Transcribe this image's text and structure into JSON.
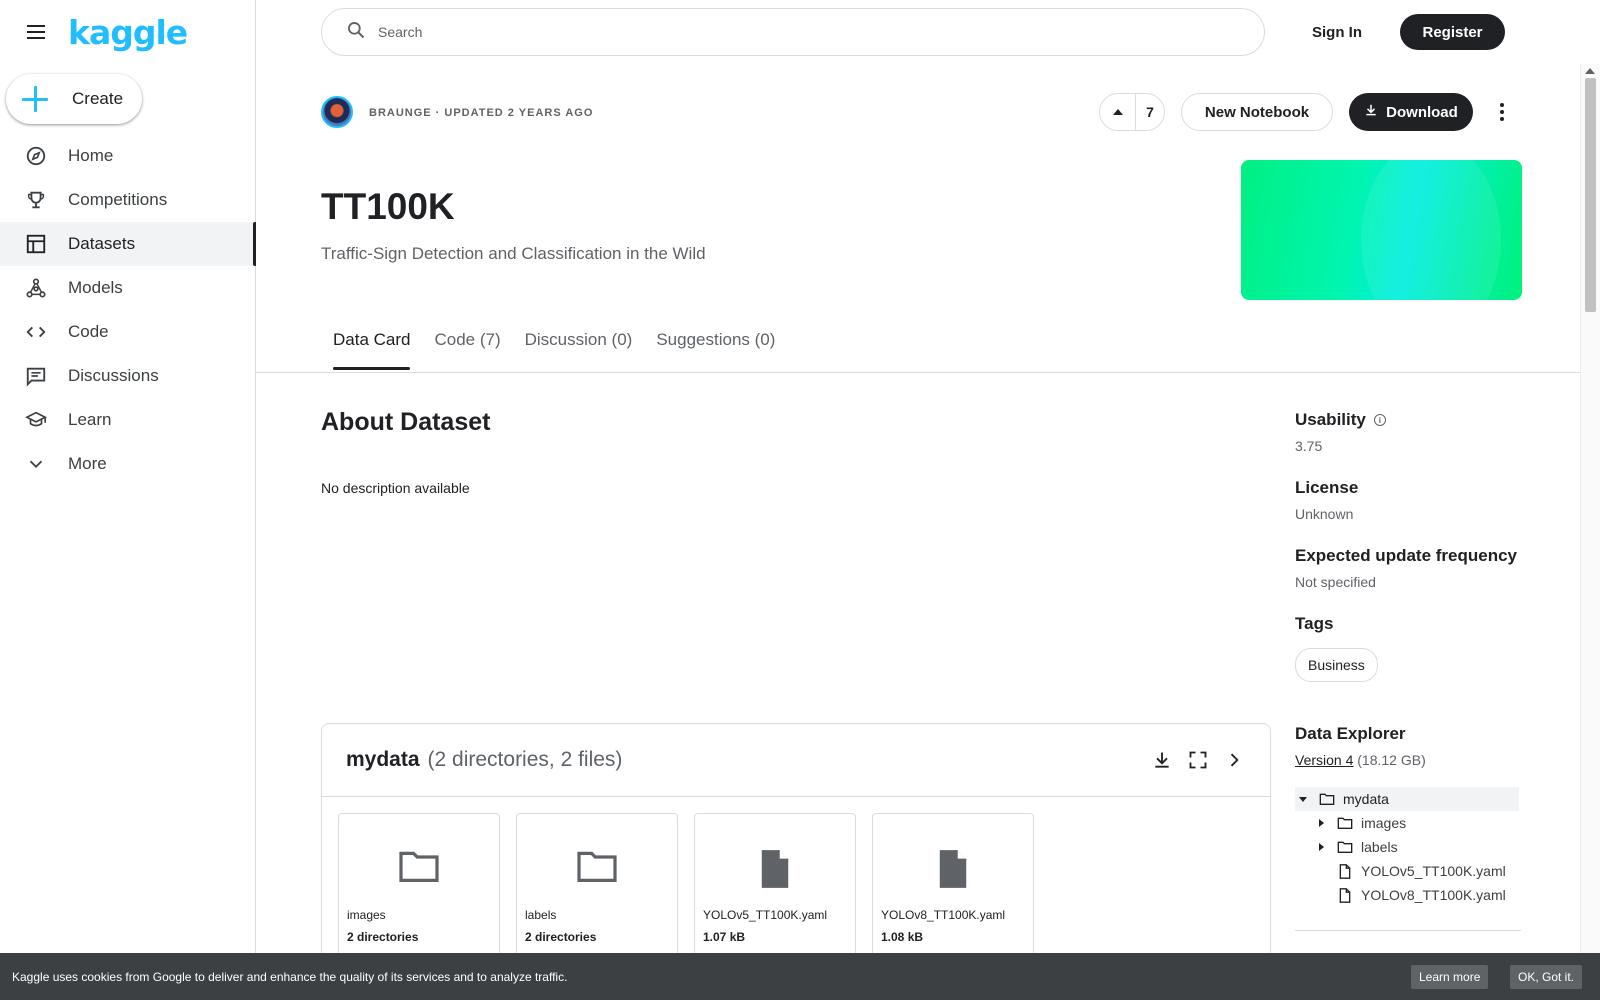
{
  "brand": {
    "logo": "kaggle"
  },
  "sidebar": {
    "create_label": "Create",
    "items": [
      {
        "label": "Home",
        "icon": "compass-icon"
      },
      {
        "label": "Competitions",
        "icon": "trophy-icon"
      },
      {
        "label": "Datasets",
        "icon": "table-icon",
        "active": true
      },
      {
        "label": "Models",
        "icon": "models-icon"
      },
      {
        "label": "Code",
        "icon": "code-icon"
      },
      {
        "label": "Discussions",
        "icon": "discussion-icon"
      },
      {
        "label": "Learn",
        "icon": "school-icon"
      },
      {
        "label": "More",
        "icon": "chevron-down-icon"
      }
    ]
  },
  "header": {
    "search_placeholder": "Search",
    "sign_in": "Sign In",
    "register": "Register"
  },
  "dataset": {
    "meta": "BRAUNGE · UPDATED 2 YEARS AGO",
    "upvotes": "7",
    "new_notebook": "New Notebook",
    "download": "Download",
    "title": "TT100K",
    "subtitle": "Traffic-Sign Detection and Classification in the Wild"
  },
  "tabs": [
    {
      "label": "Data Card",
      "active": true
    },
    {
      "label": "Code (7)"
    },
    {
      "label": "Discussion (0)"
    },
    {
      "label": "Suggestions (0)"
    }
  ],
  "about": {
    "title": "About Dataset",
    "description": "No description available"
  },
  "details": {
    "usability_label": "Usability",
    "usability_value": "3.75",
    "license_label": "License",
    "license_value": "Unknown",
    "frequency_label": "Expected update frequency",
    "frequency_value": "Not specified",
    "tags_label": "Tags",
    "tags": [
      "Business"
    ]
  },
  "data_explorer": {
    "title": "Data Explorer",
    "version": "Version 4",
    "size": "(18.12 GB)",
    "tree": [
      {
        "label": "mydata",
        "type": "folder",
        "depth": 0,
        "expanded": true,
        "selected": true
      },
      {
        "label": "images",
        "type": "folder",
        "depth": 1,
        "expanded": false
      },
      {
        "label": "labels",
        "type": "folder",
        "depth": 1,
        "expanded": false
      },
      {
        "label": "YOLOv5_TT100K.yaml",
        "type": "file",
        "depth": 1
      },
      {
        "label": "YOLOv8_TT100K.yaml",
        "type": "file",
        "depth": 1
      }
    ]
  },
  "explorer_panel": {
    "name": "mydata",
    "info": "(2 directories, 2 files)",
    "cards": [
      {
        "name": "images",
        "sub": "2 directories",
        "type": "folder"
      },
      {
        "name": "labels",
        "sub": "2 directories",
        "type": "folder"
      },
      {
        "name": "YOLOv5_TT100K.yaml",
        "sub": "1.07 kB",
        "type": "file"
      },
      {
        "name": "YOLOv8_TT100K.yaml",
        "sub": "1.08 kB",
        "type": "file"
      }
    ]
  },
  "cookie": {
    "text": "Kaggle uses cookies from Google to deliver and enhance the quality of its services and to analyze traffic.",
    "learn_more": "Learn more",
    "ok": "OK, Got it."
  },
  "colors": {
    "brand": "#20beff",
    "dark": "#202124",
    "banner_start": "#00f083",
    "banner_mid": "#00eee0"
  }
}
